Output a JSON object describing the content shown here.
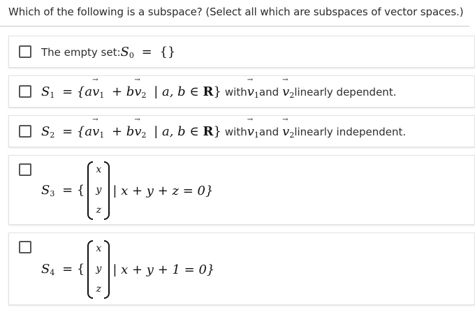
{
  "question": "Which of the following is a subspace? (Select all which are subspaces of vector spaces.)",
  "options": [
    {
      "text_prefix": "The empty set: ",
      "set_name": "S",
      "set_sub": "0",
      "eq": "=",
      "expr": "{}"
    },
    {
      "set_name": "S",
      "set_sub": "1",
      "eq": "= {a",
      "v": "v",
      "v1_sub": "1",
      "plus_b": "+ b",
      "v2_sub": "2",
      "cond": "| a, b ∈ ",
      "reals": "R",
      "close": "}",
      "with": "with ",
      "and": " and ",
      "suffix": " linearly dependent."
    },
    {
      "set_name": "S",
      "set_sub": "2",
      "eq": "= {a",
      "v": "v",
      "v1_sub": "1",
      "plus_b": "+ b",
      "v2_sub": "2",
      "cond": "| a, b ∈ ",
      "reals": "R",
      "close": "}",
      "with": "with ",
      "and": " and ",
      "suffix": " linearly independent."
    },
    {
      "set_name": "S",
      "set_sub": "3",
      "eq": "= {",
      "entries": [
        "x",
        "y",
        "z"
      ],
      "condition": "| x + y + z = 0}"
    },
    {
      "set_name": "S",
      "set_sub": "4",
      "eq": "= {",
      "entries": [
        "x",
        "y",
        "z"
      ],
      "condition": "| x + y + 1 = 0}"
    }
  ]
}
